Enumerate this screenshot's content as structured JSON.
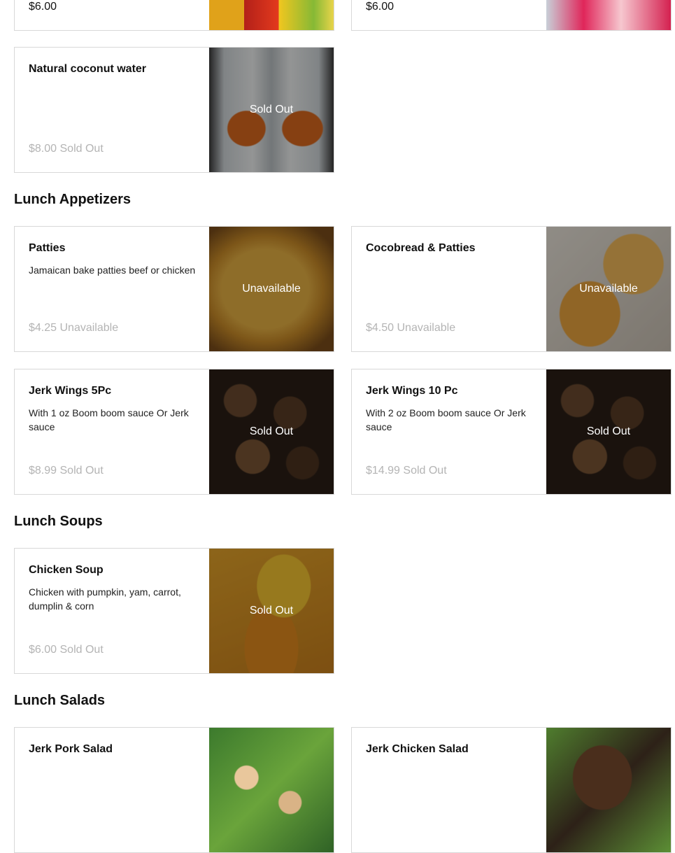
{
  "top_row": [
    {
      "price": "$6.00",
      "image": "kola champagne soda cans"
    },
    {
      "price": "$6.00",
      "image": "snapple bottles"
    }
  ],
  "sections": [
    {
      "id": "drinks",
      "items": [
        {
          "name": "Natural coconut water",
          "description": "",
          "price": "$8.00",
          "price_status": "Sold Out",
          "overlay": "Sold Out"
        }
      ]
    },
    {
      "id": "lunch-appetizers",
      "title": "Lunch Appetizers",
      "items": [
        {
          "name": "Patties",
          "description": "Jamaican bake patties beef or chicken",
          "price": "$4.25",
          "price_status": "Unavailable",
          "overlay": "Unavailable"
        },
        {
          "name": "Cocobread & Patties",
          "description": "",
          "price": "$4.50",
          "price_status": "Unavailable",
          "overlay": "Unavailable"
        },
        {
          "name": "Jerk Wings 5Pc",
          "description": "With 1 oz Boom boom sauce Or Jerk sauce",
          "price": "$8.99",
          "price_status": "Sold Out",
          "overlay": "Sold Out"
        },
        {
          "name": "Jerk Wings 10 Pc",
          "description": "With 2 oz Boom boom sauce Or Jerk sauce",
          "price": "$14.99",
          "price_status": "Sold Out",
          "overlay": "Sold Out"
        }
      ]
    },
    {
      "id": "lunch-soups",
      "title": "Lunch Soups",
      "items": [
        {
          "name": "Chicken Soup",
          "description": "Chicken with pumpkin, yam, carrot, dumplin & corn",
          "price": "$6.00",
          "price_status": "Sold Out",
          "overlay": "Sold Out"
        }
      ]
    },
    {
      "id": "lunch-salads",
      "title": "Lunch Salads",
      "items": [
        {
          "name": "Jerk Pork Salad"
        },
        {
          "name": "Jerk Chicken Salad"
        }
      ]
    }
  ],
  "colors": {
    "text": "#111111",
    "muted_price": "#b4b4b4",
    "border": "#d8d8d8",
    "overlay_text": "#ffffff"
  }
}
